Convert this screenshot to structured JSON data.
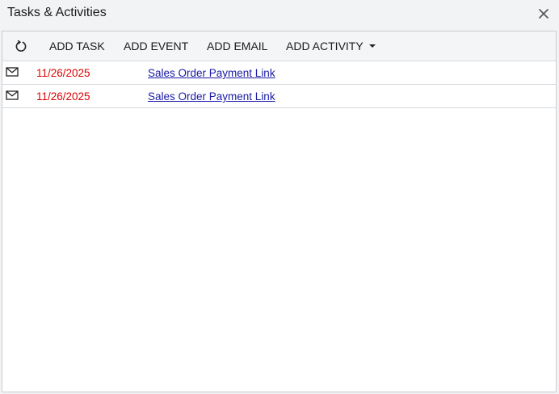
{
  "window": {
    "title": "Tasks & Activities",
    "close_icon": "close-icon"
  },
  "toolbar": {
    "refresh_icon": "refresh-icon",
    "add_task": "ADD TASK",
    "add_event": "ADD EVENT",
    "add_email": "ADD EMAIL",
    "add_activity": "ADD ACTIVITY"
  },
  "activities": [
    {
      "icon": "mail-icon",
      "date": "11/26/2025",
      "summary": "Sales Order Payment Link"
    },
    {
      "icon": "mail-icon",
      "date": "11/26/2025",
      "summary": "Sales Order Payment Link"
    }
  ],
  "colors": {
    "date_overdue": "#e00000",
    "link": "#1a1aa6"
  }
}
